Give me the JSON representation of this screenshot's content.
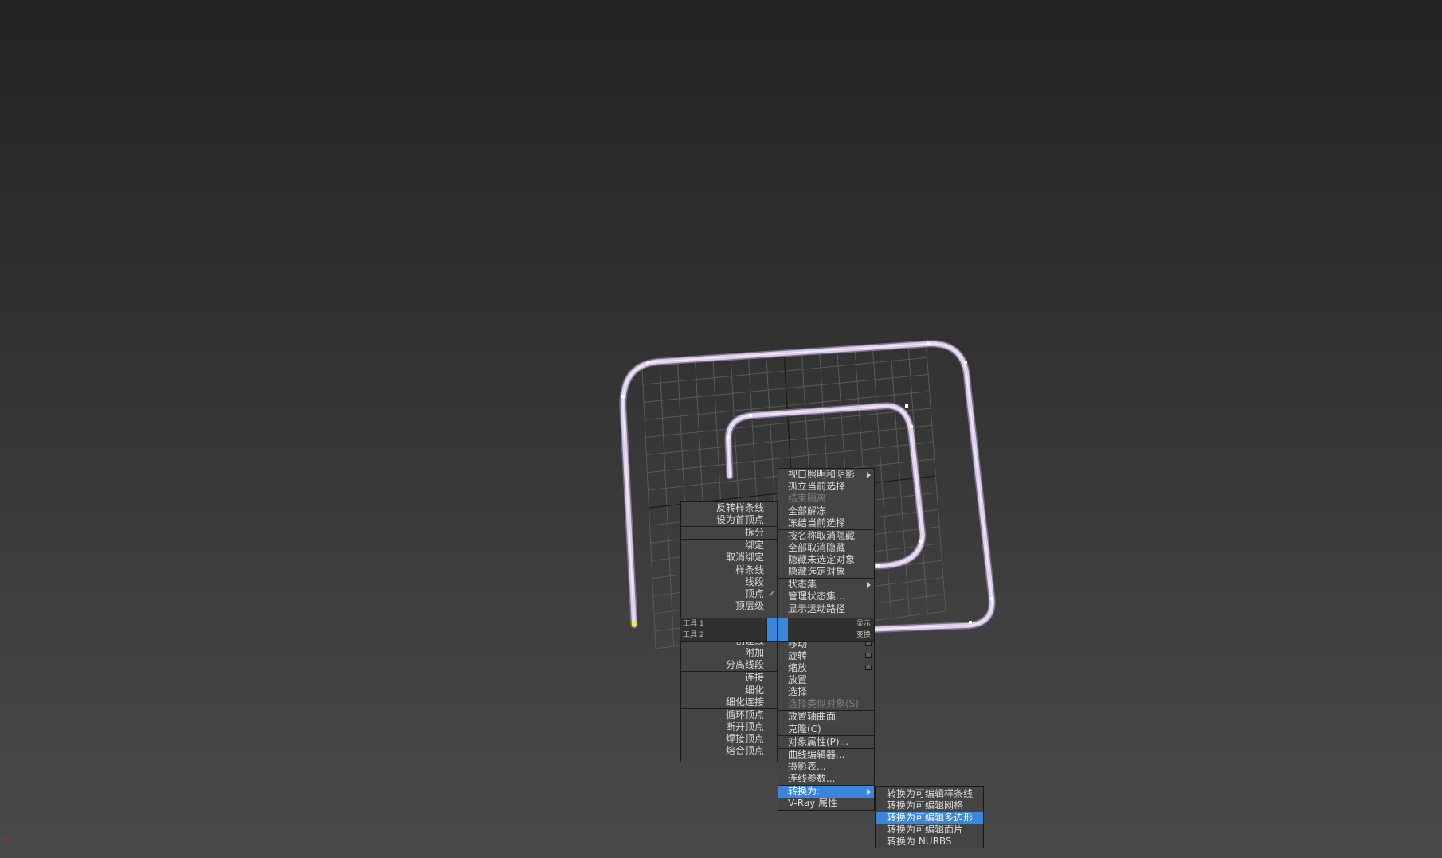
{
  "viewport": {
    "background_colors": [
      "#232323",
      "#4a4a4a"
    ],
    "spline_color": "#d8cce8",
    "grid_color": "#5a5a5a"
  },
  "left_menu": {
    "groups": [
      [
        "反转样条线",
        "设为首顶点"
      ],
      [
        "拆分"
      ],
      [
        "绑定",
        "取消绑定"
      ],
      [
        "样条线",
        "线段",
        "顶点",
        "顶层级"
      ]
    ],
    "checked_item": "顶点",
    "tools_groups": [
      [
        "创建线",
        "附加",
        "分离线段"
      ],
      [
        "连接"
      ],
      [
        "细化",
        "细化连接"
      ],
      [
        "循环顶点",
        "断开顶点",
        "焊接顶点",
        "熔合顶点"
      ]
    ]
  },
  "quad_bar": {
    "tools1_label": "工具 1",
    "tools2_label": "工具 2",
    "display_label": "显示",
    "transform_label": "变换",
    "accent": "#3a86dc"
  },
  "right_menu": {
    "display_groups": [
      [
        {
          "label": "视口照明和阴影",
          "submenu": true
        },
        {
          "label": "孤立当前选择"
        },
        {
          "label": "结束隔离",
          "disabled": true
        }
      ],
      [
        {
          "label": "全部解冻"
        },
        {
          "label": "冻结当前选择"
        }
      ],
      [
        {
          "label": "按名称取消隐藏"
        },
        {
          "label": "全部取消隐藏"
        },
        {
          "label": "隐藏未选定对象"
        },
        {
          "label": "隐藏选定对象"
        }
      ],
      [
        {
          "label": "状态集",
          "submenu": true
        },
        {
          "label": "管理状态集..."
        }
      ],
      [
        {
          "label": "显示运动路径"
        }
      ]
    ],
    "transform_groups": [
      [
        {
          "label": "移动",
          "option": true
        },
        {
          "label": "旋转",
          "option": true
        },
        {
          "label": "缩放",
          "option": true
        },
        {
          "label": "放置"
        },
        {
          "label": "选择"
        },
        {
          "label": "选择类似对象(S)",
          "disabled": true
        }
      ],
      [
        {
          "label": "放置轴曲面"
        }
      ],
      [
        {
          "label": "克隆(C)"
        }
      ],
      [
        {
          "label": "对象属性(P)..."
        }
      ],
      [
        {
          "label": "曲线编辑器..."
        },
        {
          "label": "摄影表..."
        },
        {
          "label": "连线参数..."
        }
      ],
      [
        {
          "label": "转换为:",
          "submenu": true,
          "selected": true
        },
        {
          "label": "V-Ray 属性"
        }
      ]
    ]
  },
  "submenu": {
    "items": [
      {
        "label": "转换为可编辑样条线"
      },
      {
        "label": "转换为可编辑网格"
      },
      {
        "label": "转换为可编辑多边形",
        "selected": true
      },
      {
        "label": "转换为可编辑面片"
      },
      {
        "label": "转换为 NURBS"
      }
    ]
  }
}
